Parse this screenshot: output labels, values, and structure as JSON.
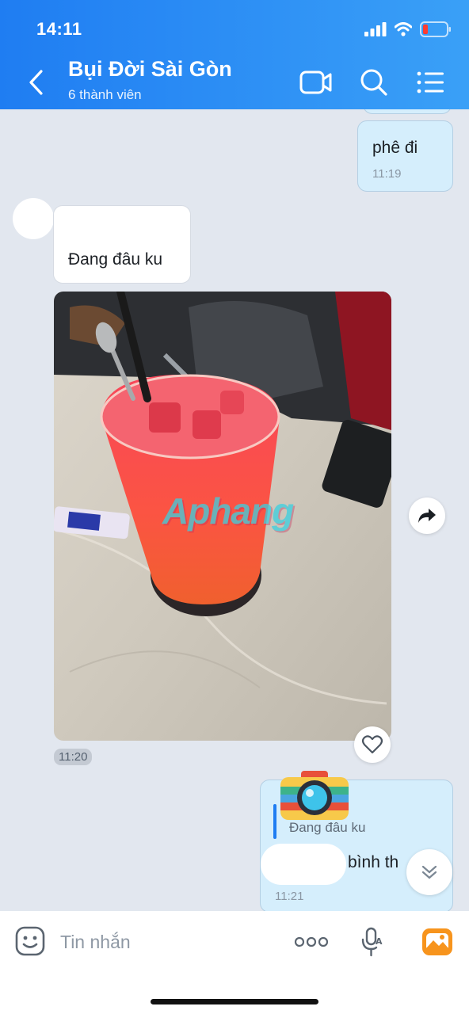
{
  "status": {
    "time": "14:11"
  },
  "header": {
    "title": "Bụi Đời Sài Gòn",
    "subtitle": "6 thành viên",
    "icons": [
      "back-icon",
      "video-call-icon",
      "search-icon",
      "menu-list-icon"
    ]
  },
  "messages": [
    {
      "type": "sent-text",
      "text": "phê đi",
      "time": "11:19"
    },
    {
      "type": "received-text",
      "text": "Đang đâu ku"
    },
    {
      "type": "received-image",
      "watermark": "Aphang",
      "time": "11:20"
    },
    {
      "type": "sent-reply",
      "quoted": "Đang đâu ku",
      "text": "bình th",
      "time": "11:21"
    }
  ],
  "input": {
    "placeholder": "Tin nhắn"
  },
  "colors": {
    "header_start": "#1f7df2",
    "header_end": "#3aa0f7",
    "sent_bubble": "#d5eefc",
    "chat_bg": "#e2e7ef"
  }
}
